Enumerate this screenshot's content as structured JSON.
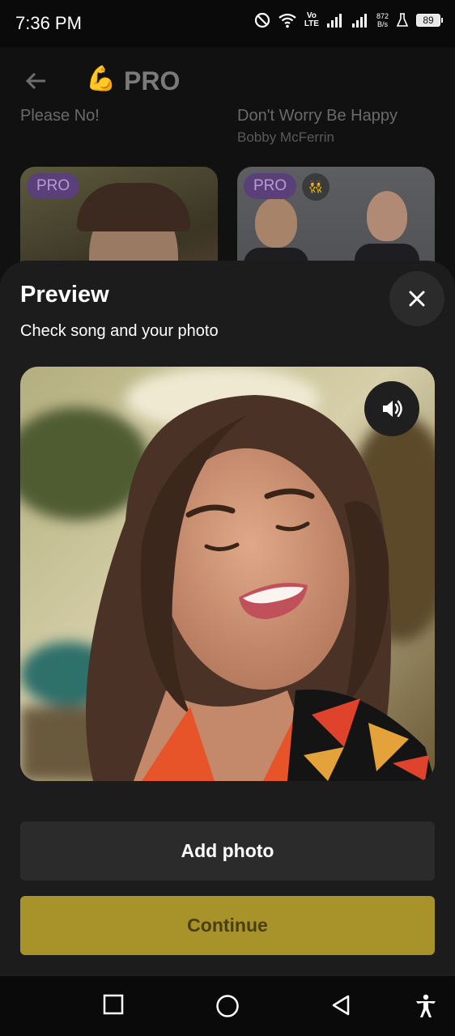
{
  "status_bar": {
    "time": "7:36 PM",
    "net_speed_value": "872",
    "net_speed_unit": "B/s",
    "volte_top": "Vo",
    "volte_bottom": "LTE",
    "battery": "89"
  },
  "background_app": {
    "header_emoji": "💪",
    "title": "PRO",
    "songs": [
      {
        "title": "Please No!",
        "artist": ""
      },
      {
        "title": "Don't Worry Be Happy",
        "artist": "Bobby McFerrin"
      }
    ],
    "cards": [
      {
        "badge": "PRO"
      },
      {
        "badge": "PRO",
        "emoji": "👯"
      }
    ]
  },
  "sheet": {
    "title": "Preview",
    "subtitle": "Check song and your photo",
    "add_photo_label": "Add photo",
    "continue_label": "Continue"
  },
  "colors": {
    "accent": "#a8922a",
    "sheet_bg": "#1c1c1c",
    "pro_badge": "#5a3f79"
  },
  "icons": {
    "close": "close-icon",
    "volume": "volume-icon",
    "back": "back-arrow-icon",
    "nav_recent": "square-icon",
    "nav_home": "circle-icon",
    "nav_back": "triangle-back-icon",
    "accessibility": "accessibility-icon"
  }
}
